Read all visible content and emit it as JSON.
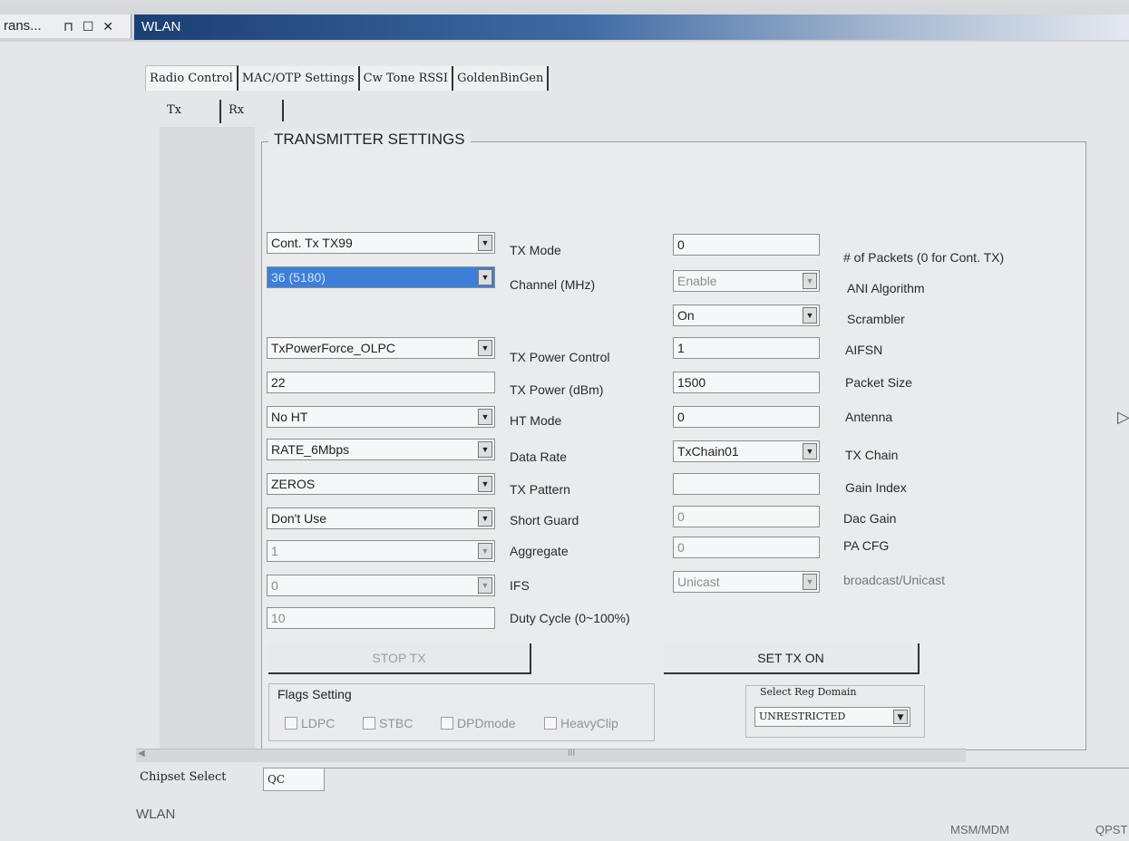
{
  "dock": {
    "tab_label": "rans...",
    "icons": "⊓ ☐ ✕"
  },
  "window": {
    "title": "WLAN"
  },
  "tabs": [
    "Radio Control",
    "MAC/OTP Settings",
    "Cw Tone RSSI",
    "GoldenBinGen"
  ],
  "subtabs": [
    "Tx",
    "Rx"
  ],
  "group_title": "TRANSMITTER SETTINGS",
  "left": {
    "tx_mode": {
      "value": "Cont. Tx TX99",
      "label": "TX Mode"
    },
    "channel": {
      "value": "36 (5180)",
      "label": "Channel (MHz)"
    },
    "tx_power_control": {
      "value": "TxPowerForce_OLPC",
      "label": "TX Power Control"
    },
    "tx_power": {
      "value": "22",
      "label": "TX Power (dBm)"
    },
    "ht_mode": {
      "value": "No HT",
      "label": "HT Mode"
    },
    "data_rate": {
      "value": "RATE_6Mbps",
      "label": "Data Rate"
    },
    "tx_pattern": {
      "value": "ZEROS",
      "label": "TX Pattern"
    },
    "short_guard": {
      "value": "Don't Use",
      "label": "Short Guard"
    },
    "aggregate": {
      "value": "1",
      "label": "Aggregate"
    },
    "ifs": {
      "value": "0",
      "label": "IFS"
    },
    "duty_cycle": {
      "value": "10",
      "label": "Duty Cycle (0~100%)"
    }
  },
  "right": {
    "packets": {
      "value": "0",
      "label": "# of Packets (0 for Cont. TX)"
    },
    "ani": {
      "value": "Enable",
      "label": "ANI Algorithm"
    },
    "scrambler": {
      "value": "On",
      "label": "Scrambler"
    },
    "aifsn": {
      "value": "1",
      "label": "AIFSN"
    },
    "packet_size": {
      "value": "1500",
      "label": "Packet Size"
    },
    "antenna": {
      "value": "0",
      "label": "Antenna"
    },
    "tx_chain": {
      "value": "TxChain01",
      "label": "TX Chain"
    },
    "gain_index": {
      "value": "",
      "label": "Gain Index"
    },
    "dac_gain": {
      "value": "0",
      "label": "Dac Gain"
    },
    "pa_cfg": {
      "value": "0",
      "label": "PA CFG"
    },
    "cast": {
      "value": "Unicast",
      "label": "broadcast/Unicast"
    }
  },
  "buttons": {
    "stop_tx": "STOP TX",
    "set_tx_on": "SET TX ON"
  },
  "flags": {
    "title": "Flags Setting",
    "items": [
      "LDPC",
      "STBC",
      "DPDmode",
      "HeavyClip"
    ]
  },
  "reg_domain": {
    "title": "Select Reg Domain",
    "value": "UNRESTRICTED"
  },
  "scrollbar": {
    "thumb": "III"
  },
  "chipset": {
    "label": "Chipset Select",
    "value": "QC"
  },
  "status": {
    "left": "WLAN",
    "mid": "MSM/MDM",
    "right": "QPST"
  },
  "cursor": "▷"
}
